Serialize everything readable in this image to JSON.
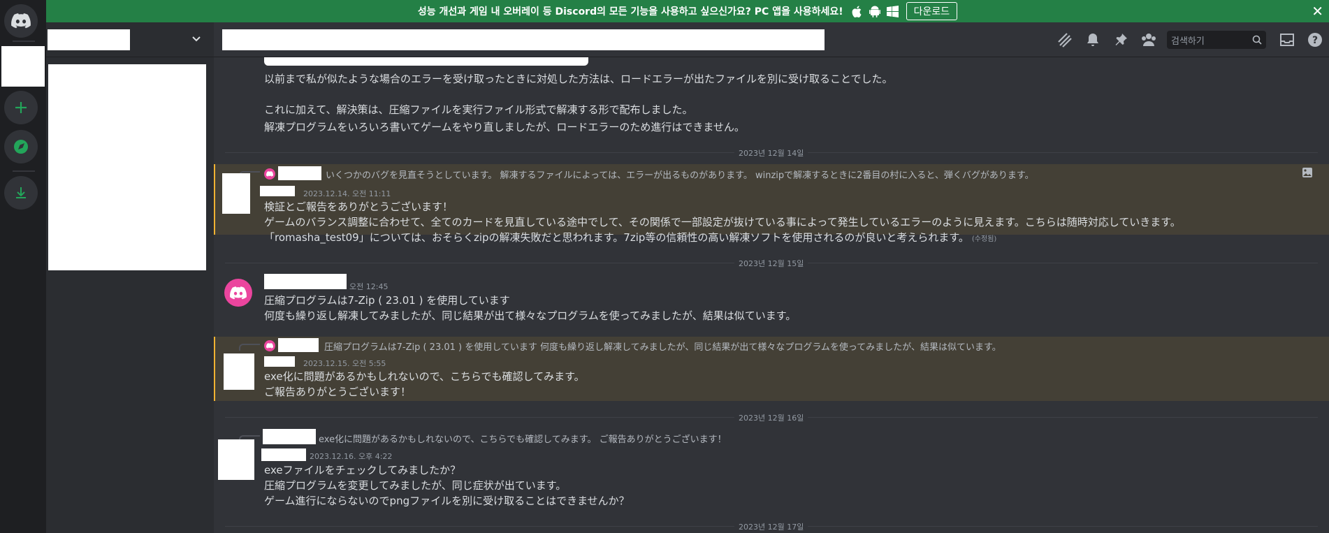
{
  "banner": {
    "text": "성능 개선과 게임 내 오버레이 등 Discord의 모든 기능을 사용하고 싶으신가요? PC 앱을 사용하세요!",
    "download_label": "다운로드"
  },
  "topbar": {
    "search_placeholder": "검색하기"
  },
  "messages": {
    "top_line1": "以前まで私が似たような場合のエラーを受け取ったときに対処した方法は、ロードエラーが出たファイルを別に受け取ることでした。",
    "top_line2": "これに加えて、解決策は、圧縮ファイルを実行ファイル形式で解凍する形で配布しました。",
    "top_line3": "解凍プログラムをいろいろ書いてゲームをやり直しましたが、ロードエラーのため進行はできません。",
    "date1": "2023년 12월 14일",
    "m1_reply": "いくつかのバグを見直そうとしています。 解凍するファイルによっては、エラーが出るものがあります。 winzipで解凍するときに2番目の村に入ると、弾くバグがあります。",
    "m1_ts": "2023.12.14. 오전 11:11",
    "m1_line1": "検証とご報告をありがとうございます！",
    "m1_line2": "ゲームのバランス調整に合わせて、全てのカードを見直している途中でして、その関係で一部設定が抜けている事によって発生しているエラーのように見えます。こちらは随時対応していきます。",
    "m1_line3": "「romasha_test09」については、おそらくzipの解凍失敗だと思われます。7zip等の信頼性の高い解凍ソフトを使用されるのが良いと考えられます。",
    "m1_edited": "(수정됨)",
    "date2": "2023년 12월 15일",
    "m2_ts": "오전 12:45",
    "m2_line1": "圧縮プログラムは7-Zip ( 23.01 ) を使用しています",
    "m2_line2": "何度も繰り返し解凍してみましたが、同じ結果が出て様々なプログラムを使ってみましたが、結果は似ています。",
    "m3_reply": "圧縮プログラムは7-Zip ( 23.01 ) を使用しています 何度も繰り返し解凍してみましたが、同じ結果が出て様々なプログラムを使ってみましたが、結果は似ています。",
    "m3_ts": "2023.12.15. 오전 5:55",
    "m3_line1": "exe化に問題があるかもしれないので、こちらでも確認してみます。",
    "m3_line2": "ご報告ありがとうございます！",
    "date3": "2023년 12월 16일",
    "m4_reply": "exe化に問題があるかもしれないので、こちらでも確認してみます。 ご報告ありがとうございます！",
    "m4_ts": "2023.12.16. 오후 4:22",
    "m4_line1": "exeファイルをチェックしてみましたか？",
    "m4_line2": "圧縮プログラムを変更してみましたが、同じ症状が出ています。",
    "m4_line3": "ゲーム進行にならないのでpngファイルを別に受け取ることはできませんか？",
    "date4": "2023년 12월 17일"
  },
  "colors": {
    "banner": "#248046",
    "accent_green": "#23a55a",
    "highlight": "#f0b232",
    "avatar_pink": "#eb459e"
  }
}
